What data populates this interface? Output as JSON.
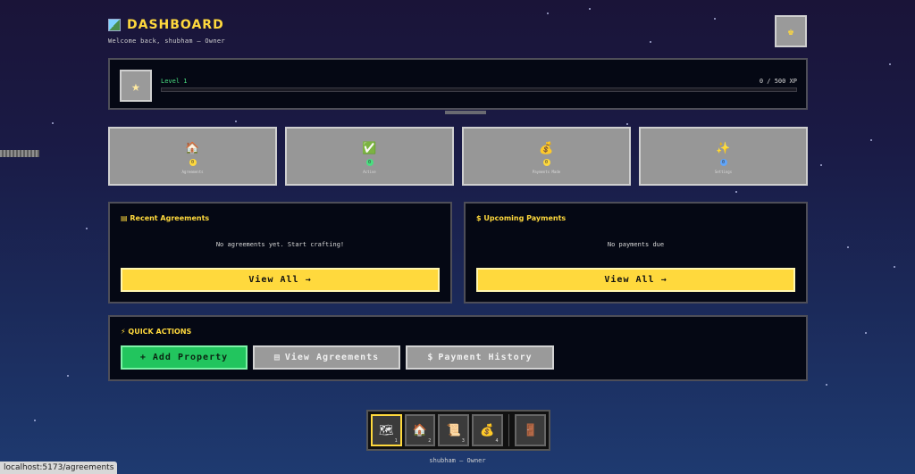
{
  "header": {
    "icon": "map-picture-icon",
    "title": "DASHBOARD",
    "subtitle": "Welcome back, shubham — Owner"
  },
  "user_button": {
    "icon": "crown-icon",
    "glyph": "♚"
  },
  "level": {
    "label": "Level 1",
    "xp_text": "0 / 500 XP",
    "progress": 0
  },
  "stats": [
    {
      "icon": "house-icon",
      "glyph": "🏠",
      "value": "0",
      "label": "Agreements",
      "color": "#ffd93d"
    },
    {
      "icon": "checkmark-icon",
      "glyph": "✅",
      "value": "0",
      "label": "Active",
      "color": "#4ade80"
    },
    {
      "icon": "money-bag-icon",
      "glyph": "💰",
      "value": "0",
      "label": "Payments Made",
      "color": "#ffd93d"
    },
    {
      "icon": "sparkle-icon",
      "glyph": "✨",
      "value": "0",
      "label": "Settings",
      "color": "#60a5fa"
    }
  ],
  "recent": {
    "icon": "scroll-icon",
    "title": "Recent Agreements",
    "empty": "No agreements yet. Start crafting!",
    "button": "View All →"
  },
  "upcoming": {
    "icon": "money-bag-icon",
    "title": "Upcoming Payments",
    "empty": "No payments due",
    "button": "View All →"
  },
  "quick_actions": {
    "title": "⚡ QUICK ACTIONS",
    "add_property": "+ Add Property",
    "view_agreements": "View Agreements",
    "payment_history": "Payment History"
  },
  "hotbar": {
    "slots": [
      {
        "icon": "map-picture-icon",
        "glyph": "🗺",
        "num": "1"
      },
      {
        "icon": "house-icon",
        "glyph": "🏠",
        "num": "2"
      },
      {
        "icon": "scroll-icon",
        "glyph": "📜",
        "num": "3"
      },
      {
        "icon": "money-bag-icon",
        "glyph": "💰",
        "num": "4"
      }
    ],
    "door": {
      "icon": "door-icon",
      "glyph": "🚪"
    }
  },
  "footer_user": "shubham — Owner",
  "status_url": "localhost:5173/agreements"
}
